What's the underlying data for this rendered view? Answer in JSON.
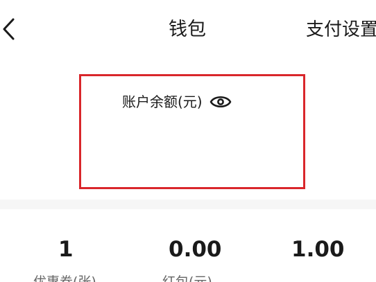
{
  "nav": {
    "title": "钱包",
    "pay_settings": "支付设置"
  },
  "balance": {
    "label": "账户余额(元)"
  },
  "stats": [
    {
      "value": "1",
      "label": "优惠券(张)"
    },
    {
      "value": "0.00",
      "label": "红包(元)"
    },
    {
      "value": "1.00",
      "label": ""
    }
  ],
  "colors": {
    "highlight_border": "#d9262b",
    "text": "#1a1a1a",
    "muted_text": "#666666"
  },
  "icons": {
    "back": "chevron-left-icon",
    "eye": "eye-icon"
  }
}
